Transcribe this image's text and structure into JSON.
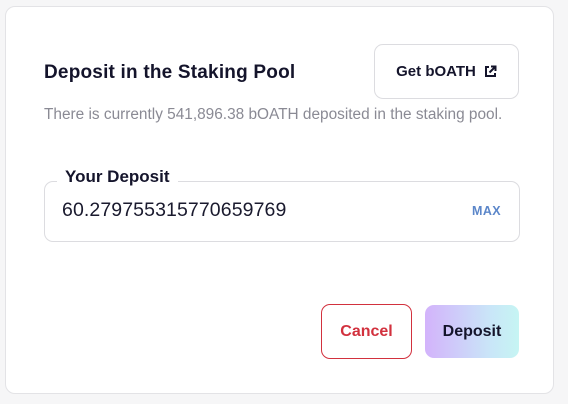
{
  "dialog": {
    "title": "Deposit in the Staking Pool",
    "get_button": {
      "label": "Get bOATH",
      "icon": "external-link-icon"
    },
    "subtitle": "There is currently 541,896.38 bOATH deposited in the staking pool.",
    "deposit_field": {
      "label": "Your Deposit",
      "value": "60.279755315770659769",
      "max_label": "MAX"
    },
    "actions": {
      "cancel_label": "Cancel",
      "deposit_label": "Deposit"
    }
  },
  "colors": {
    "text_primary": "#14142b",
    "text_muted": "#8a8a94",
    "cancel_red": "#d2313e",
    "max_blue": "#5b86c9",
    "deposit_gradient_start": "#d3b3fb",
    "deposit_gradient_end": "#c6f5f3"
  }
}
